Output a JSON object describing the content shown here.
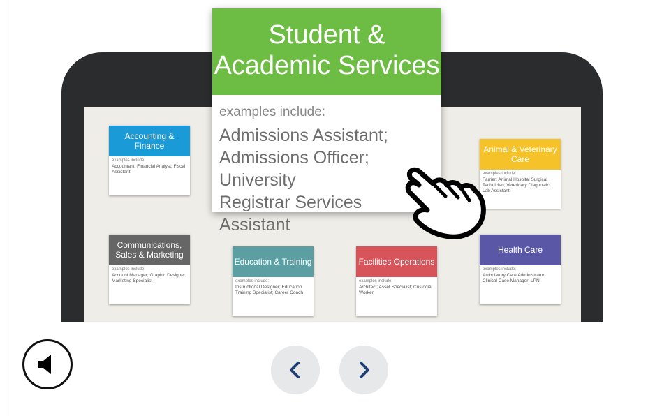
{
  "popup": {
    "title_line1": "Student &",
    "title_line2": "Academic Services",
    "examples_label": "examples include:",
    "examples_line1": "Admissions Assistant;",
    "examples_line2": "Admissions Officer; University",
    "examples_line3": "Registrar Services Assistant",
    "color": "#6dbd45"
  },
  "cards": {
    "accounting": {
      "title": "Accounting & Finance",
      "examples_label": "examples include:",
      "examples": "Accountant; Financial Analyst; Fiscal Assistant",
      "color": "#1a9ad6"
    },
    "animal": {
      "title": "Animal & Veterinary Care",
      "examples_label": "examples include:",
      "examples": "Farrier; Animal Hospital Surgical Technician; Veterinary Diagnostic Lab Assistant",
      "color": "#f5c22a"
    },
    "communications": {
      "title": "Communications, Sales & Marketing",
      "examples_label": "examples include:",
      "examples": "Account Manager; Graphic Designer; Marketing Specialist",
      "color": "#666666"
    },
    "education": {
      "title": "Education & Training",
      "examples_label": "examples include:",
      "examples": "Instructional Designer; Education Training Specialist; Career Coach",
      "color": "#5b9fa3"
    },
    "facilities": {
      "title": "Facilities Operations",
      "examples_label": "examples include:",
      "examples": "Architect; Asset Specialist; Custodial Worker",
      "color": "#d6545a"
    },
    "health": {
      "title": "Health Care",
      "examples_label": "examples include:",
      "examples": "Ambulatory Care Administrator; Clinical Case Manager; LPN",
      "color": "#5a57a6"
    }
  },
  "icons": {
    "audio": "speaker-icon",
    "prev": "chevron-left-icon",
    "next": "chevron-right-icon",
    "cursor": "hand-pointer-icon"
  }
}
